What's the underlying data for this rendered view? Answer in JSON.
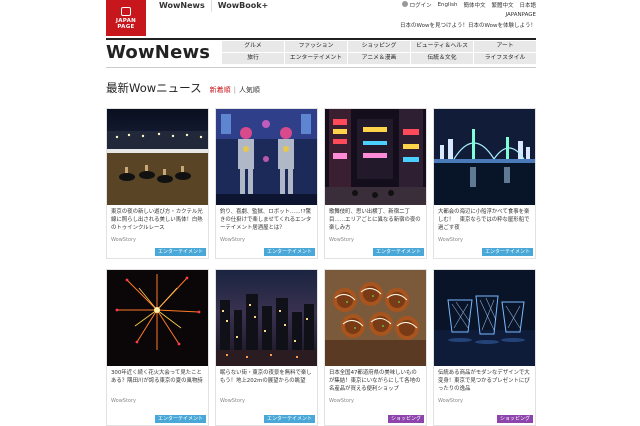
{
  "logo": {
    "line1": "JAPAN",
    "line2": "PAGE"
  },
  "top_tabs": [
    "WowNews",
    "WowBook+"
  ],
  "utility": {
    "login": "ログイン",
    "english": "English",
    "zh_hans": "簡体中文",
    "zh_hant": "繁體中文",
    "japanese": "日本語"
  },
  "brand": "JAPANPAGE",
  "tagline": "日本のWowを見つけよう！日本のWowを体験しよう！",
  "site_title": "WowNews",
  "categories": [
    "グルメ",
    "ファッション",
    "ショッピング",
    "ビューティ＆ヘルス",
    "アート",
    "旅行",
    "エンターテイメント",
    "アニメ＆漫画",
    "伝統＆文化",
    "ライフスタイル"
  ],
  "section": {
    "title": "最新Wowニュース",
    "sort_new": "新着順",
    "separator": "|",
    "sort_popular": "人気順"
  },
  "colors": {
    "brand_red": "#c8161d",
    "badge_entertainment": "#4aa8d8",
    "badge_shopping": "#8e44ad"
  },
  "cards": [
    {
      "desc": "東京の夜の新しい遊び方・カクテル光線に照らし出される美しい馬体！白熱のトゥインクルレース",
      "source": "WowStory",
      "badge": "エンターテイメント",
      "image": "horse-race-night-image"
    },
    {
      "desc": "釣り、喜劇、監獄、ロボット……!?驚きの仕掛けで楽しませてくれるエンターテイメント居酒屋とは？",
      "source": "WowStory",
      "badge": "エンターテイメント",
      "image": "robot-show-image"
    },
    {
      "desc": "歌舞伎町、思い出横丁、新宿二丁目……エリアごとに異なる新宿の夜の楽しみ方",
      "source": "WowStory",
      "badge": "エンターテイメント",
      "image": "shinjuku-night-image"
    },
    {
      "desc": "大都会の海辺に小船浮かべて食事を楽しむ！　東京ならではの粋な屋形船で過ごす夜",
      "source": "WowStory",
      "badge": "エンターテイメント",
      "image": "rainbow-bridge-image"
    },
    {
      "desc": "300年近く続く花火大会って見たことある？隅田川が誇る東京の夏の風物詩",
      "source": "WowStory",
      "badge": "エンターテイメント",
      "image": "fireworks-image"
    },
    {
      "desc": "眠らない街・東京の夜景を無料で楽しもう！地上202mの展望からの眺望",
      "source": "WowStory",
      "badge": "エンターテイメント",
      "image": "tokyo-nightview-image"
    },
    {
      "desc": "日本全国47都道府県の美味しいものが集結！東京にいながらにして各地の名産品が買える便利ショップ",
      "source": "WowStory",
      "badge": "ショッピング",
      "image": "takoyaki-image"
    },
    {
      "desc": "伝統ある商品がモダンなデザインで大変身！東京で見つかるプレゼントにぴったりの逸品",
      "source": "WowStory",
      "badge": "ショッピング",
      "image": "glassware-image"
    }
  ]
}
